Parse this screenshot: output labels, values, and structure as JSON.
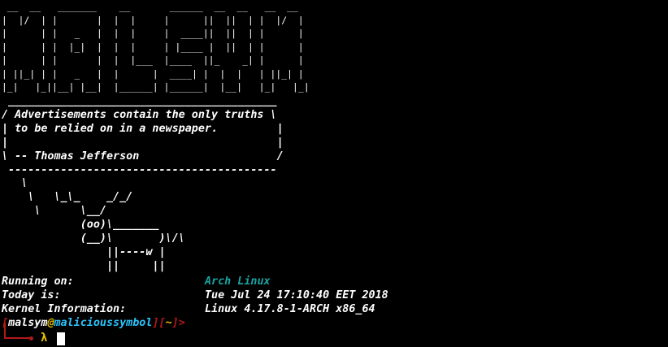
{
  "banner_art": " __  __   _______    __       ______  __  __   __  __\n|  |/  | |       |  |  |     |      ||  ||  | |  |/  |\n|      | |   _   |  |  |     |  ____||  ||  | |      |\n|      | |  |_|  |  |  |     | |____ |  ||  | |      |\n|      | |       |  |  |___  |____  ||_    _| |      |\n| ||_| | |   _   |  |      |  ____| |  |  |   | ||_| |\n|_|   |_||__| |__|  |______| |______|  |__|   |_|   |_|",
  "cowsay": {
    "art": " _________________________________________\n/ Advertisements contain the only truths \\\n| to be relied on in a newspaper.         |\n|                                         |\n\\ -- Thomas Jefferson                     /\n -----------------------------------------\n   \\\n    \\   \\_\\_    _/_/\n     \\      \\__/\n            (oo)\\_______\n            (__)\\       )\\/\\\n                ||----w |\n                ||     ||"
  },
  "info": [
    {
      "label": "Running on:",
      "value": "Arch Linux"
    },
    {
      "label": "Today is:",
      "value": "Tue Jul 24 17:10:40 EET 2018"
    },
    {
      "label": "Kernel Information:",
      "value": "Linux 4.17.8-1-ARCH x86_64"
    }
  ],
  "prompt": {
    "open_bracket": "[",
    "user": "malsym",
    "at": "@",
    "host": "malicioussymbol",
    "close_bracket": "]",
    "dir_open": "[",
    "dir": "~",
    "dir_close": "]",
    "arrow": ">",
    "lambda": "λ"
  },
  "colors": {
    "background": "#000000",
    "text": "#ffffff",
    "distro": "#1aa3a3",
    "prompt_bracket": "#b21818",
    "prompt_at": "#e5c000",
    "prompt_host": "#2bc6ff"
  }
}
